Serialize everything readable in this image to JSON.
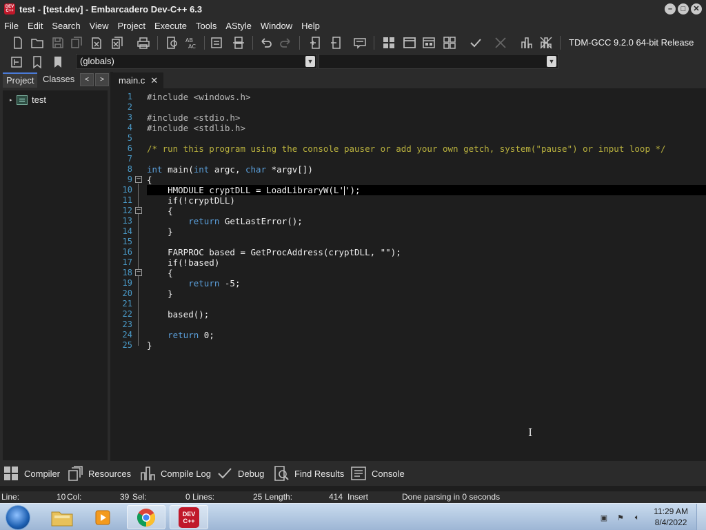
{
  "window": {
    "title": "test - [test.dev] - Embarcadero Dev-C++ 6.3",
    "logo_text": "DEV C++",
    "controls": [
      "–",
      "□",
      "✕"
    ]
  },
  "menu": [
    "File",
    "Edit",
    "Search",
    "View",
    "Project",
    "Execute",
    "Tools",
    "AStyle",
    "Window",
    "Help"
  ],
  "toolbar": {
    "compiler": "TDM-GCC 9.2.0 64-bit Release",
    "scope_combo": "(globals)",
    "function_combo": ""
  },
  "left_panel": {
    "tabs": [
      "Project",
      "Classes"
    ],
    "nav_prev": "<",
    "nav_next": ">",
    "tree": [
      {
        "label": "test"
      }
    ]
  },
  "editor": {
    "tab_label": "main.c",
    "tab_close": "✕",
    "current_line": 10,
    "line_numbers": [
      "1",
      "2",
      "3",
      "4",
      "5",
      "6",
      "7",
      "8",
      "9",
      "10",
      "11",
      "12",
      "13",
      "14",
      "15",
      "16",
      "17",
      "18",
      "19",
      "20",
      "21",
      "22",
      "23",
      "24",
      "25"
    ]
  },
  "bottom_tabs": [
    "Compiler",
    "Resources",
    "Compile Log",
    "Debug",
    "Find Results",
    "Console"
  ],
  "status": {
    "line_label": "Line:",
    "line": "10",
    "col_label": "Col:",
    "col": "39",
    "sel_label": "Sel:",
    "sel": "0",
    "lines_label": "Lines:",
    "lines": "25",
    "length_label": "Length:",
    "length": "414",
    "mode": "Insert",
    "message": "Done parsing in 0 seconds"
  },
  "taskbar": {
    "apps": [
      "windows-explorer",
      "media-player",
      "chrome",
      "dev-cpp"
    ],
    "time": "11:29 AM",
    "date": "8/4/2022"
  }
}
